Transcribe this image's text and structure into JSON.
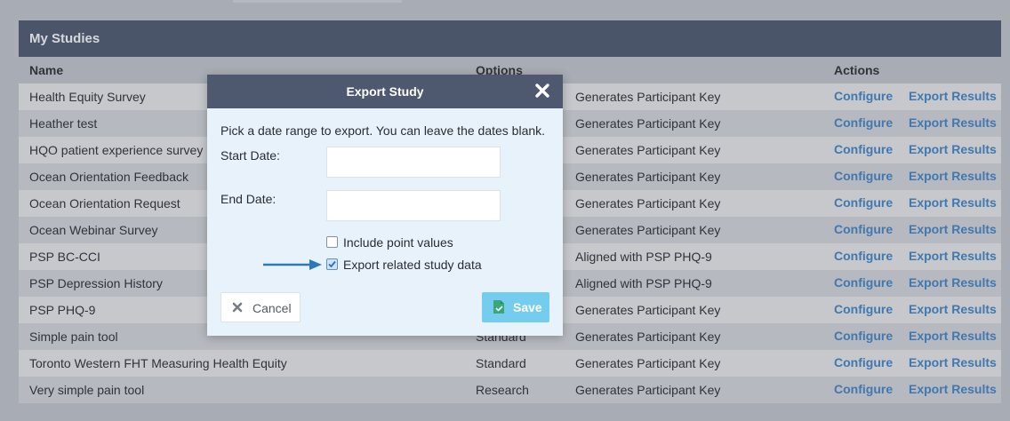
{
  "panel": {
    "title": "My Studies",
    "columns": {
      "name": "Name",
      "options": "Options",
      "actions": "Actions"
    }
  },
  "studies": [
    {
      "name": "Health Equity Survey",
      "type": "",
      "option": "Generates Participant Key",
      "configure": "Configure",
      "export": "Export Results"
    },
    {
      "name": "Heather test",
      "type": "",
      "option": "Generates Participant Key",
      "configure": "Configure",
      "export": "Export Results"
    },
    {
      "name": "HQO patient experience survey",
      "type": "",
      "option": "Generates Participant Key",
      "configure": "Configure",
      "export": "Export Results"
    },
    {
      "name": "Ocean Orientation Feedback",
      "type": "",
      "option": "Generates Participant Key",
      "configure": "Configure",
      "export": "Export Results"
    },
    {
      "name": "Ocean Orientation Request",
      "type": "",
      "option": "Generates Participant Key",
      "configure": "Configure",
      "export": "Export Results"
    },
    {
      "name": "Ocean Webinar Survey",
      "type": "",
      "option": "Generates Participant Key",
      "configure": "Configure",
      "export": "Export Results"
    },
    {
      "name": "PSP BC-CCI",
      "type": "",
      "option": "Aligned with PSP PHQ-9",
      "configure": "Configure",
      "export": "Export Results"
    },
    {
      "name": "PSP Depression History",
      "type": "",
      "option": "Aligned with PSP PHQ-9",
      "configure": "Configure",
      "export": "Export Results"
    },
    {
      "name": "PSP PHQ-9",
      "type": "",
      "option": "Generates Participant Key",
      "configure": "Configure",
      "export": "Export Results"
    },
    {
      "name": "Simple pain tool",
      "type": "Standard",
      "option": "Generates Participant Key",
      "configure": "Configure",
      "export": "Export Results"
    },
    {
      "name": "Toronto Western FHT Measuring Health Equity",
      "type": "Standard",
      "option": "Generates Participant Key",
      "configure": "Configure",
      "export": "Export Results"
    },
    {
      "name": "Very simple pain tool",
      "type": "Research",
      "option": "Generates Participant Key",
      "configure": "Configure",
      "export": "Export Results"
    }
  ],
  "modal": {
    "title": "Export Study",
    "instructions": "Pick a date range to export. You can leave the dates blank.",
    "start_date_label": "Start Date:",
    "start_date_value": "",
    "end_date_label": "End Date:",
    "end_date_value": "",
    "include_points_label": "Include point values",
    "include_points_checked": false,
    "export_related_label": "Export related study data",
    "export_related_checked": true,
    "cancel_label": "Cancel",
    "save_label": "Save"
  },
  "colors": {
    "header_bg": "#4e5970",
    "link": "#3f86c8",
    "save_button": "#74cdee",
    "annotation_arrow": "#2a7ab8"
  }
}
